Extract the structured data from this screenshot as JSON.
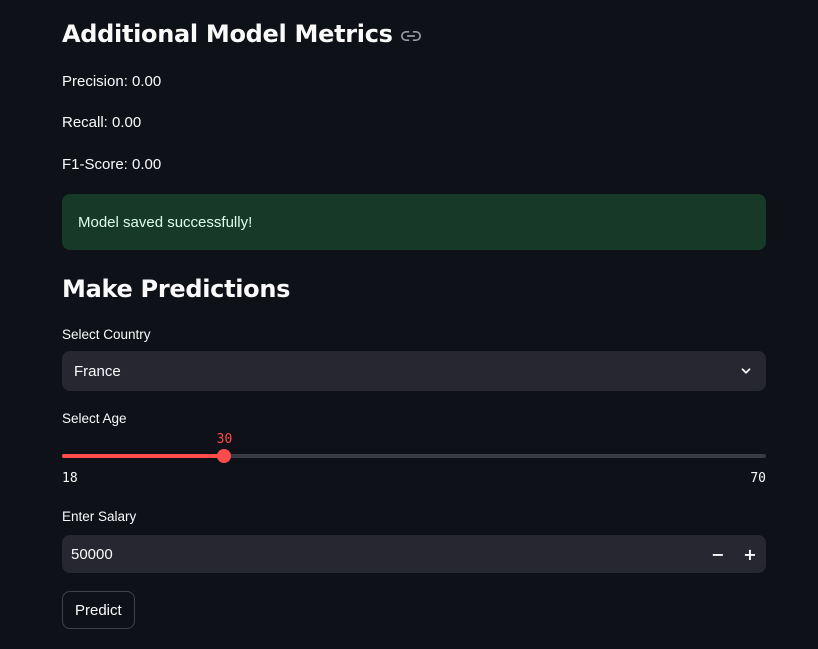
{
  "metrics_section": {
    "title": "Additional Model Metrics",
    "items": [
      {
        "label": "Precision: 0.00"
      },
      {
        "label": "Recall: 0.00"
      },
      {
        "label": "F1-Score: 0.00"
      }
    ]
  },
  "alert": {
    "message": "Model saved successfully!"
  },
  "predictions_section": {
    "title": "Make Predictions",
    "country": {
      "label": "Select Country",
      "value": "France"
    },
    "age": {
      "label": "Select Age",
      "value": 30,
      "min": 18,
      "max": 70,
      "value_text": "30",
      "min_text": "18",
      "max_text": "70"
    },
    "salary": {
      "label": "Enter Salary",
      "value": "50000",
      "decrement": "−",
      "increment": "+"
    },
    "predict_button": "Predict"
  },
  "colors": {
    "background": "#0e1117",
    "accent": "#ff4b4b",
    "success_bg": "#173928",
    "success_text": "#dffde9",
    "widget_bg": "#262730"
  },
  "icons": {
    "anchor": "link-icon",
    "select": "chevron-down-icon"
  }
}
